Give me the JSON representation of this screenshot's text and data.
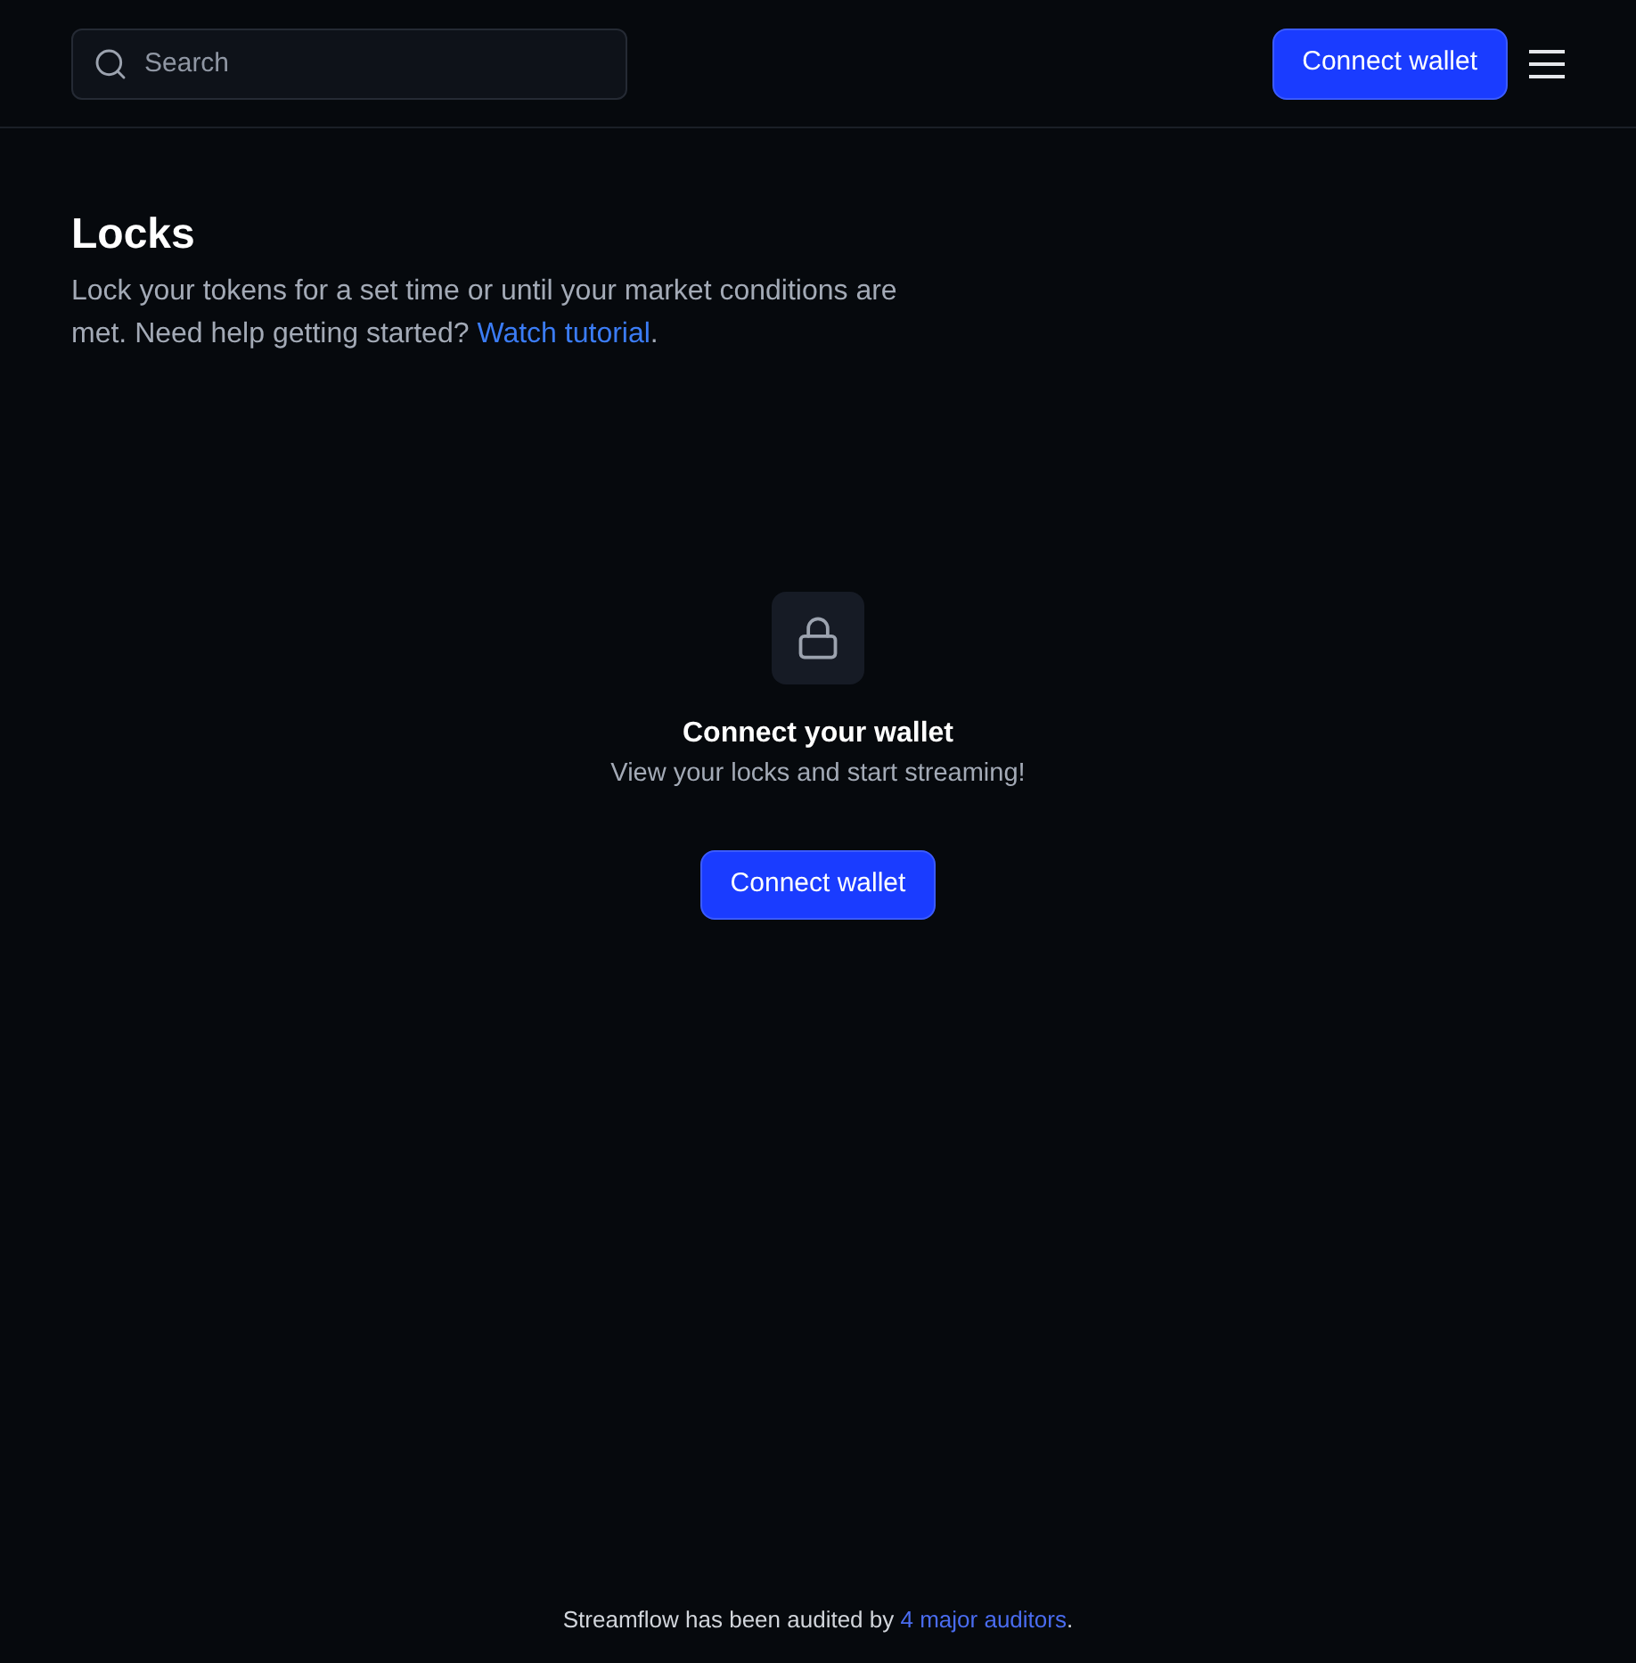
{
  "header": {
    "search": {
      "placeholder": "Search"
    },
    "connect_button": "Connect wallet"
  },
  "intro": {
    "title": "Locks",
    "description": "Lock your tokens for a set time or until your market conditions are met. Need help getting started?",
    "link": "Watch tutorial",
    "after_link": "."
  },
  "empty_state": {
    "title": "Connect your wallet",
    "subtitle": "View your locks and start streaming!",
    "button": "Connect wallet"
  },
  "footer": {
    "text": "Streamflow has been audited by",
    "link": "4 major auditors",
    "after_link": "."
  }
}
